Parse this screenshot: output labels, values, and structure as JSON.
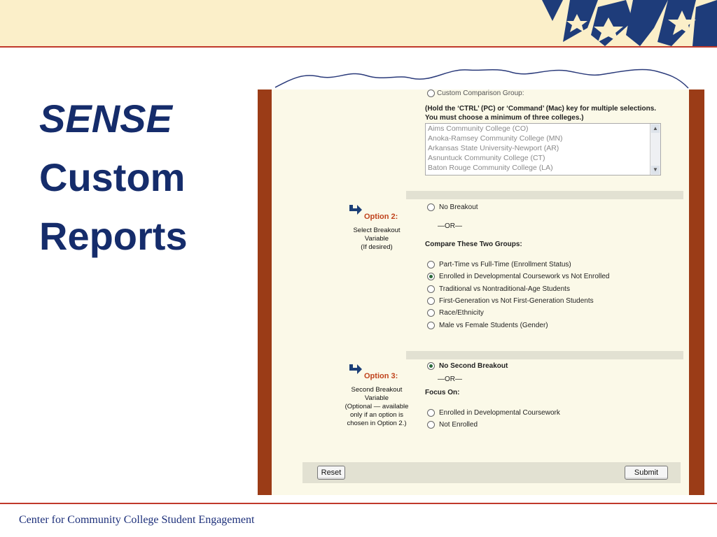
{
  "slide": {
    "title_line1": "SENSE",
    "title_line2": "Custom",
    "title_line3": "Reports",
    "footer": "Center for Community College Student Engagement"
  },
  "form": {
    "custom_group_label": "Custom Comparison Group:",
    "instruction_line1": "(Hold the ‘CTRL’ (PC) or ‘Command’ (Mac) key for multiple selections.",
    "instruction_line2": "You must choose a minimum of three colleges.)",
    "colleges": [
      "Aims Community College (CO)",
      "Anoka-Ramsey Community College (MN)",
      "Arkansas State University-Newport (AR)",
      "Asnuntuck Community College (CT)",
      "Baton Rouge Community College (LA)"
    ],
    "option2": {
      "label": "Option 2:",
      "desc_line1": "Select Breakout",
      "desc_line2": "Variable",
      "desc_line3": "(If desired)",
      "no_breakout": "No Breakout",
      "or": "—OR—",
      "compare_heading": "Compare These Two Groups:",
      "choices": [
        {
          "label": "Part-Time vs Full-Time (Enrollment Status)",
          "selected": false
        },
        {
          "label": "Enrolled in Developmental Coursework vs Not Enrolled",
          "selected": true
        },
        {
          "label": "Traditional vs Nontraditional-Age Students",
          "selected": false
        },
        {
          "label": "First-Generation vs Not First-Generation Students",
          "selected": false
        },
        {
          "label": "Race/Ethnicity",
          "selected": false
        },
        {
          "label": "Male vs Female Students (Gender)",
          "selected": false
        }
      ]
    },
    "option3": {
      "label": "Option 3:",
      "desc_line1": "Second Breakout",
      "desc_line2": "Variable",
      "desc_line3": "(Optional — available",
      "desc_line4": "only if an option is",
      "desc_line5": "chosen in Option 2.)",
      "no_second": "No Second Breakout",
      "or": "—OR—",
      "focus_heading": "Focus On:",
      "focus_choices": [
        {
          "label": "Enrolled in Developmental Coursework",
          "selected": false
        },
        {
          "label": "Not Enrolled",
          "selected": false
        }
      ]
    },
    "reset_label": "Reset",
    "submit_label": "Submit"
  },
  "colors": {
    "title": "#152c6b",
    "accent_red": "#c0392b",
    "frame": "#9b3c17",
    "option_label": "#c0421b"
  }
}
